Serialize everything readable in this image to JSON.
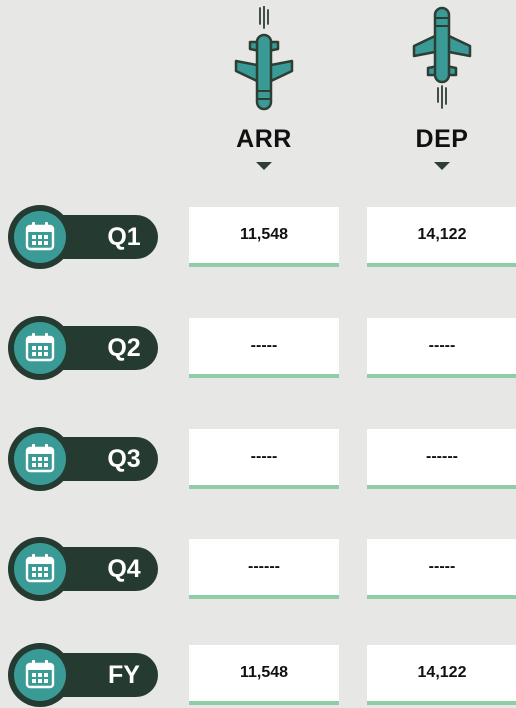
{
  "columns": {
    "arr": {
      "label": "ARR",
      "icon": "arriving-plane-icon"
    },
    "dep": {
      "label": "DEP",
      "icon": "departing-plane-icon"
    }
  },
  "rows": [
    {
      "label": "Q1",
      "arr": "11,548",
      "dep": "14,122",
      "icon": "calendar-icon"
    },
    {
      "label": "Q2",
      "arr": "-----",
      "dep": "-----",
      "icon": "calendar-icon"
    },
    {
      "label": "Q3",
      "arr": "-----",
      "dep": "------",
      "icon": "calendar-icon"
    },
    {
      "label": "Q4",
      "arr": "------",
      "dep": "-----",
      "icon": "calendar-icon"
    },
    {
      "label": "FY",
      "arr": "11,548",
      "dep": "14,122",
      "icon": "calendar-icon"
    }
  ],
  "colors": {
    "background": "#e7e7e6",
    "badge_dark": "#253a30",
    "badge_teal": "#3a9a96",
    "plane_fill": "#3a9a96",
    "cell_underline": "#8fcda6"
  }
}
